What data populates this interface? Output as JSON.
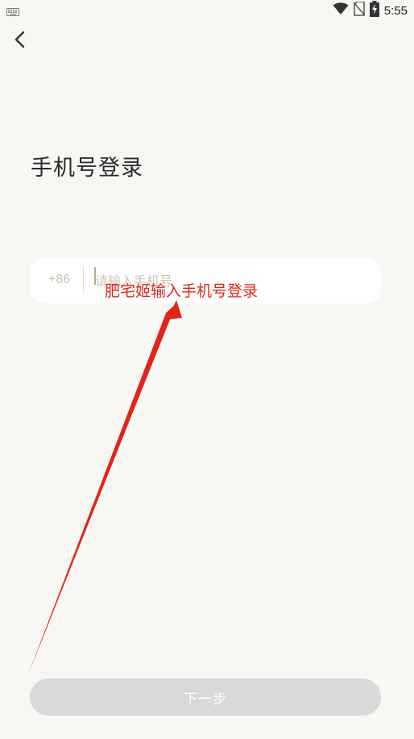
{
  "status_bar": {
    "time": "5:55",
    "icons": [
      "keyboard-icon",
      "wifi-icon",
      "no-sim-icon",
      "battery-charging-icon"
    ]
  },
  "header": {
    "back_icon": "chevron-left-icon"
  },
  "page": {
    "title": "手机号登录"
  },
  "phone_input": {
    "country_code": "+86",
    "placeholder": "请输入手机号",
    "value": ""
  },
  "annotation": {
    "text": "肥宅姬输入手机号登录",
    "color": "#e0251b"
  },
  "actions": {
    "next_label": "下一步",
    "next_disabled": true
  },
  "colors": {
    "background": "#f8f7f4",
    "input_bg": "#ffffff",
    "placeholder": "#cfc4b1",
    "button_disabled": "#d9d9d9",
    "annotation_red": "#e0251b"
  }
}
